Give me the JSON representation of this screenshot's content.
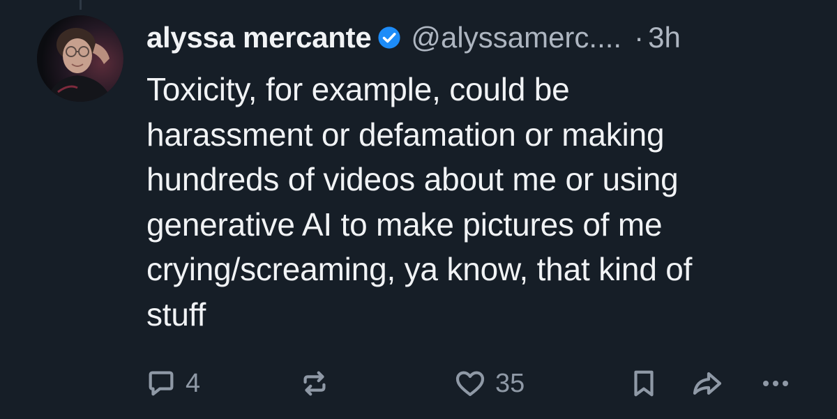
{
  "post": {
    "author": {
      "display_name": "alyssa mercante",
      "handle": "@alyssamerc....",
      "verified": true
    },
    "separator": "·",
    "time": "3h",
    "text": "Toxicity, for example, could be\nharassment or defamation or making\nhundreds of videos about me or using\ngenerative AI to make pictures of me\ncrying/screaming, ya know, that kind of\nstuff"
  },
  "actions": {
    "reply_count": "4",
    "like_count": "35"
  },
  "colors": {
    "background": "#161e27",
    "text": "#f1f3f5",
    "muted": "#aeb6c1",
    "icon": "#8f99a6",
    "verified": "#1d8cf8"
  },
  "icons": [
    "verified-badge-icon",
    "reply-icon",
    "repost-icon",
    "like-icon",
    "bookmark-icon",
    "share-icon",
    "more-icon"
  ]
}
